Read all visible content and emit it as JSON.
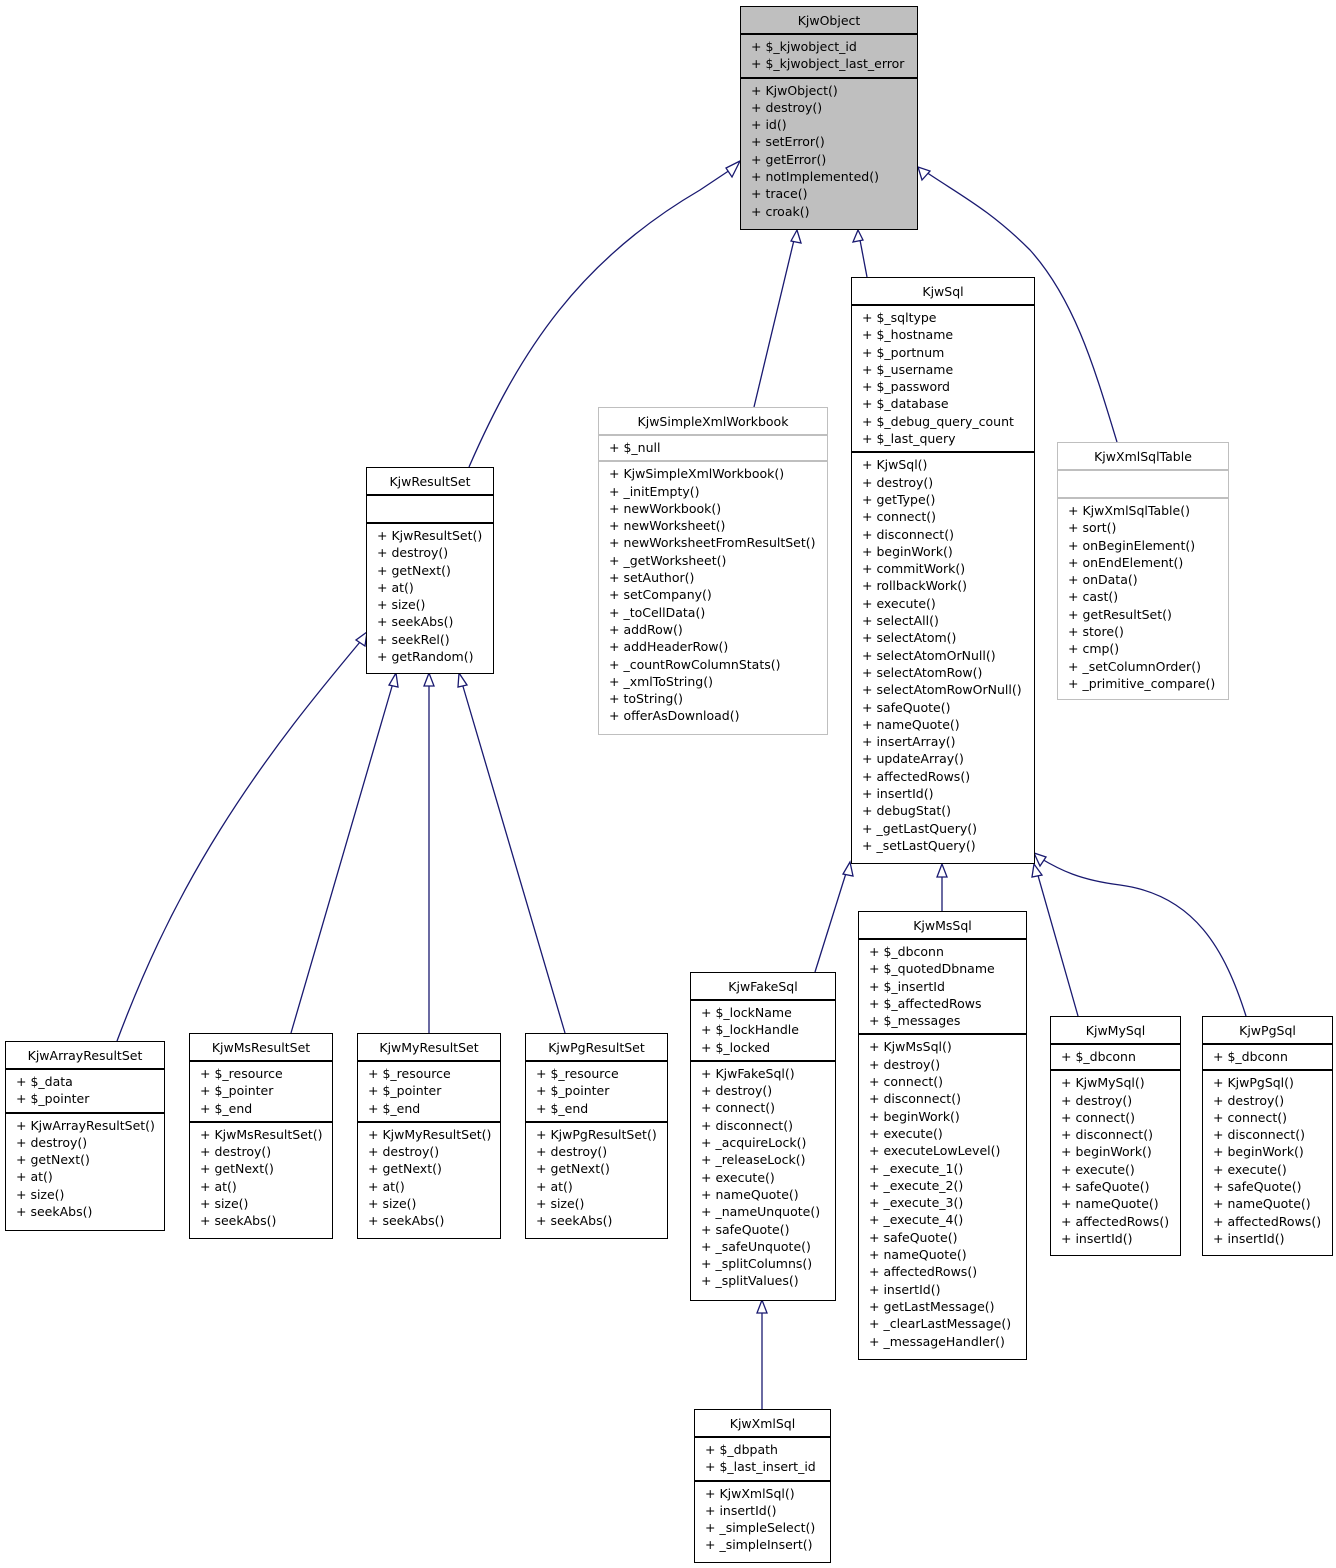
{
  "diagram": {
    "type": "uml-class-inheritance",
    "edge_color": "#191970",
    "focus_fill": "#bfbfbf",
    "classes": {
      "KjwObject": {
        "name": "KjwObject",
        "attributes": [
          "+ $_kjwobject_id",
          "+ $_kjwobject_last_error"
        ],
        "methods": [
          "+ KjwObject()",
          "+ destroy()",
          "+ id()",
          "+ setError()",
          "+ getError()",
          "+ notImplemented()",
          "+ trace()",
          "+ croak()"
        ]
      },
      "KjwResultSet": {
        "name": "KjwResultSet",
        "attributes": [],
        "methods": [
          "+ KjwResultSet()",
          "+ destroy()",
          "+ getNext()",
          "+ at()",
          "+ size()",
          "+ seekAbs()",
          "+ seekRel()",
          "+ getRandom()"
        ]
      },
      "KjwSimpleXmlWorkbook": {
        "name": "KjwSimpleXmlWorkbook",
        "attributes": [
          "+ $_null"
        ],
        "methods": [
          "+ KjwSimpleXmlWorkbook()",
          "+ _initEmpty()",
          "+ newWorkbook()",
          "+ newWorksheet()",
          "+ newWorksheetFromResultSet()",
          "+ _getWorksheet()",
          "+ setAuthor()",
          "+ setCompany()",
          "+ _toCellData()",
          "+ addRow()",
          "+ addHeaderRow()",
          "+ _countRowColumnStats()",
          "+ _xmlToString()",
          "+ toString()",
          "+ offerAsDownload()"
        ]
      },
      "KjwSql": {
        "name": "KjwSql",
        "attributes": [
          "+ $_sqltype",
          "+ $_hostname",
          "+ $_portnum",
          "+ $_username",
          "+ $_password",
          "+ $_database",
          "+ $_debug_query_count",
          "+ $_last_query"
        ],
        "methods": [
          "+ KjwSql()",
          "+ destroy()",
          "+ getType()",
          "+ connect()",
          "+ disconnect()",
          "+ beginWork()",
          "+ commitWork()",
          "+ rollbackWork()",
          "+ execute()",
          "+ selectAll()",
          "+ selectAtom()",
          "+ selectAtomOrNull()",
          "+ selectAtomRow()",
          "+ selectAtomRowOrNull()",
          "+ safeQuote()",
          "+ nameQuote()",
          "+ insertArray()",
          "+ updateArray()",
          "+ affectedRows()",
          "+ insertId()",
          "+ debugStat()",
          "+ _getLastQuery()",
          "+ _setLastQuery()"
        ]
      },
      "KjwXmlSqlTable": {
        "name": "KjwXmlSqlTable",
        "attributes": [],
        "methods": [
          "+ KjwXmlSqlTable()",
          "+ sort()",
          "+ onBeginElement()",
          "+ onEndElement()",
          "+ onData()",
          "+ cast()",
          "+ getResultSet()",
          "+ store()",
          "+ cmp()",
          "+ _setColumnOrder()",
          "+ _primitive_compare()"
        ]
      },
      "KjwArrayResultSet": {
        "name": "KjwArrayResultSet",
        "attributes": [
          "+ $_data",
          "+ $_pointer"
        ],
        "methods": [
          "+ KjwArrayResultSet()",
          "+ destroy()",
          "+ getNext()",
          "+ at()",
          "+ size()",
          "+ seekAbs()"
        ]
      },
      "KjwMsResultSet": {
        "name": "KjwMsResultSet",
        "attributes": [
          "+ $_resource",
          "+ $_pointer",
          "+ $_end"
        ],
        "methods": [
          "+ KjwMsResultSet()",
          "+ destroy()",
          "+ getNext()",
          "+ at()",
          "+ size()",
          "+ seekAbs()"
        ]
      },
      "KjwMyResultSet": {
        "name": "KjwMyResultSet",
        "attributes": [
          "+ $_resource",
          "+ $_pointer",
          "+ $_end"
        ],
        "methods": [
          "+ KjwMyResultSet()",
          "+ destroy()",
          "+ getNext()",
          "+ at()",
          "+ size()",
          "+ seekAbs()"
        ]
      },
      "KjwPgResultSet": {
        "name": "KjwPgResultSet",
        "attributes": [
          "+ $_resource",
          "+ $_pointer",
          "+ $_end"
        ],
        "methods": [
          "+ KjwPgResultSet()",
          "+ destroy()",
          "+ getNext()",
          "+ at()",
          "+ size()",
          "+ seekAbs()"
        ]
      },
      "KjwFakeSql": {
        "name": "KjwFakeSql",
        "attributes": [
          "+ $_lockName",
          "+ $_lockHandle",
          "+ $_locked"
        ],
        "methods": [
          "+ KjwFakeSql()",
          "+ destroy()",
          "+ connect()",
          "+ disconnect()",
          "+ _acquireLock()",
          "+ _releaseLock()",
          "+ execute()",
          "+ nameQuote()",
          "+ _nameUnquote()",
          "+ safeQuote()",
          "+ _safeUnquote()",
          "+ _splitColumns()",
          "+ _splitValues()"
        ]
      },
      "KjwMsSql": {
        "name": "KjwMsSql",
        "attributes": [
          "+ $_dbconn",
          "+ $_quotedDbname",
          "+ $_insertId",
          "+ $_affectedRows",
          "+ $_messages"
        ],
        "methods": [
          "+ KjwMsSql()",
          "+ destroy()",
          "+ connect()",
          "+ disconnect()",
          "+ beginWork()",
          "+ execute()",
          "+ executeLowLevel()",
          "+ _execute_1()",
          "+ _execute_2()",
          "+ _execute_3()",
          "+ _execute_4()",
          "+ safeQuote()",
          "+ nameQuote()",
          "+ affectedRows()",
          "+ insertId()",
          "+ getLastMessage()",
          "+ _clearLastMessage()",
          "+ _messageHandler()"
        ]
      },
      "KjwMySql": {
        "name": "KjwMySql",
        "attributes": [
          "+ $_dbconn"
        ],
        "methods": [
          "+ KjwMySql()",
          "+ destroy()",
          "+ connect()",
          "+ disconnect()",
          "+ beginWork()",
          "+ execute()",
          "+ safeQuote()",
          "+ nameQuote()",
          "+ affectedRows()",
          "+ insertId()"
        ]
      },
      "KjwPgSql": {
        "name": "KjwPgSql",
        "attributes": [
          "+ $_dbconn"
        ],
        "methods": [
          "+ KjwPgSql()",
          "+ destroy()",
          "+ connect()",
          "+ disconnect()",
          "+ beginWork()",
          "+ execute()",
          "+ safeQuote()",
          "+ nameQuote()",
          "+ affectedRows()",
          "+ insertId()"
        ]
      },
      "KjwXmlSql": {
        "name": "KjwXmlSql",
        "attributes": [
          "+ $_dbpath",
          "+ $_last_insert_id"
        ],
        "methods": [
          "+ KjwXmlSql()",
          "+ insertId()",
          "+ _simpleSelect()",
          "+ _simpleInsert()"
        ]
      }
    },
    "inheritance": [
      {
        "child": "KjwResultSet",
        "parent": "KjwObject"
      },
      {
        "child": "KjwSimpleXmlWorkbook",
        "parent": "KjwObject"
      },
      {
        "child": "KjwSql",
        "parent": "KjwObject"
      },
      {
        "child": "KjwXmlSqlTable",
        "parent": "KjwObject"
      },
      {
        "child": "KjwArrayResultSet",
        "parent": "KjwResultSet"
      },
      {
        "child": "KjwMsResultSet",
        "parent": "KjwResultSet"
      },
      {
        "child": "KjwMyResultSet",
        "parent": "KjwResultSet"
      },
      {
        "child": "KjwPgResultSet",
        "parent": "KjwResultSet"
      },
      {
        "child": "KjwFakeSql",
        "parent": "KjwSql"
      },
      {
        "child": "KjwMsSql",
        "parent": "KjwSql"
      },
      {
        "child": "KjwMySql",
        "parent": "KjwSql"
      },
      {
        "child": "KjwPgSql",
        "parent": "KjwSql"
      },
      {
        "child": "KjwXmlSql",
        "parent": "KjwFakeSql"
      }
    ]
  }
}
